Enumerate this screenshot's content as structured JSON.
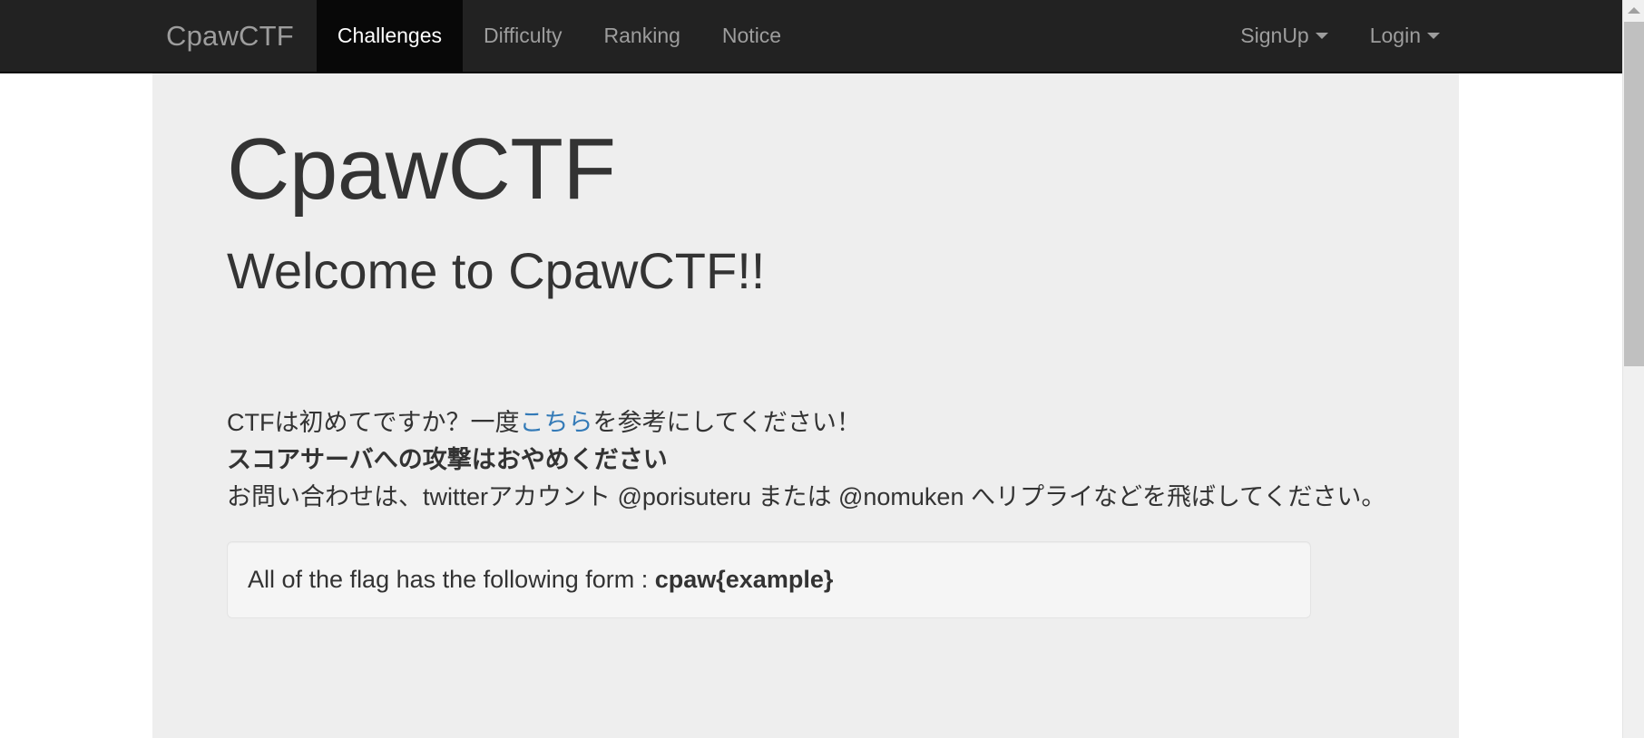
{
  "navbar": {
    "brand": "CpawCTF",
    "left_items": [
      {
        "label": "Challenges",
        "active": true
      },
      {
        "label": "Difficulty",
        "active": false
      },
      {
        "label": "Ranking",
        "active": false
      },
      {
        "label": "Notice",
        "active": false
      }
    ],
    "right_items": [
      {
        "label": "SignUp",
        "caret": true
      },
      {
        "label": "Login",
        "caret": true
      }
    ],
    "background_color": "#222222",
    "active_background_color": "#080808",
    "link_color": "#9d9d9d"
  },
  "jumbotron": {
    "title": "CpawCTF",
    "subtitle": "Welcome to CpawCTF!!",
    "background_color": "#eeeeee",
    "intro": {
      "before_link": "CTFは初めてですか？一度",
      "link_text": "こちら",
      "link_color": "#337ab7",
      "after_link": "を参考にしてください！"
    },
    "warning": "スコアサーバへの攻撃はおやめください",
    "contact": "お問い合わせは、twitterアカウント @porisuteru または @nomuken へリプライなどを飛ばしてください。",
    "flag_well": {
      "prefix": "All of the flag has the following form : ",
      "example": "cpaw{example}",
      "background_color": "#f5f5f5",
      "border_color": "#e3e3e3"
    }
  },
  "scrollbar": {
    "up_arrow": "scroll-up-arrow",
    "thumb": "scroll-thumb"
  }
}
